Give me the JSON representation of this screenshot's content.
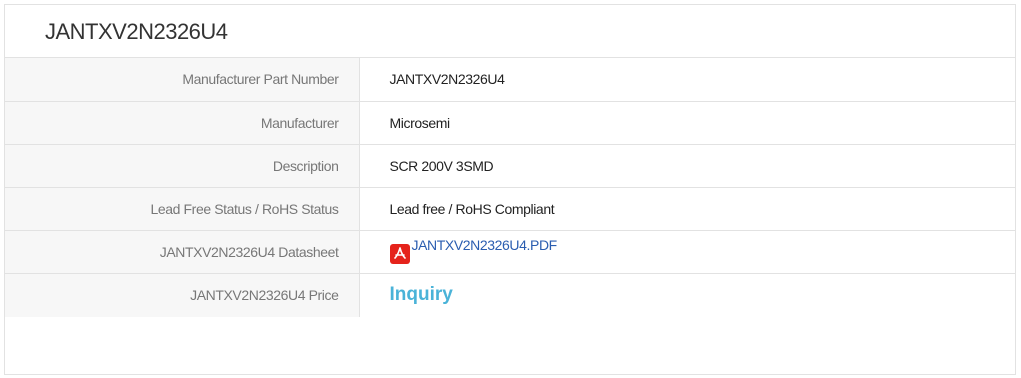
{
  "title": "JANTXV2N2326U4",
  "rows": [
    {
      "label": "Manufacturer Part Number",
      "value": "JANTXV2N2326U4"
    },
    {
      "label": "Manufacturer",
      "value": "Microsemi"
    },
    {
      "label": "Description",
      "value": "SCR 200V 3SMD"
    },
    {
      "label": "Lead Free Status / RoHS Status",
      "value": "Lead free / RoHS Compliant"
    },
    {
      "label": "JANTXV2N2326U4 Datasheet",
      "value": "JANTXV2N2326U4.PDF",
      "icon": "pdf-icon"
    },
    {
      "label": "JANTXV2N2326U4 Price",
      "value": "Inquiry"
    }
  ],
  "colors": {
    "link": "#2a5db0",
    "inquiry": "#4ab3d8",
    "pdf": "#e5231b"
  }
}
